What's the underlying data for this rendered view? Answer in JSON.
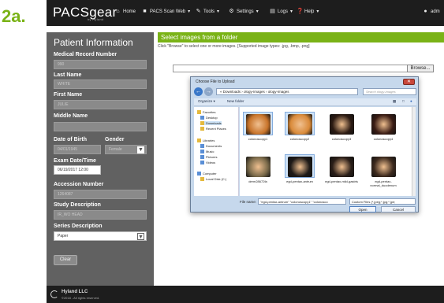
{
  "step_label": "2a.",
  "app": {
    "brand": "PACSgear",
    "brand_sub": "by Hyland",
    "nav": [
      {
        "label": "Home",
        "icon": "home-icon"
      },
      {
        "label": "PACS Scan Web",
        "icon": "camera-icon"
      },
      {
        "label": "Tools",
        "icon": "wrench-icon"
      },
      {
        "label": "Settings",
        "icon": "gear-icon"
      },
      {
        "label": "Logs",
        "icon": "list-icon"
      },
      {
        "label": "Help",
        "icon": "help-icon"
      }
    ],
    "user": "adm"
  },
  "sidebar": {
    "title": "Patient Information",
    "mrn_label": "Medical Record Number",
    "mrn_value": "990",
    "last_name_label": "Last Name",
    "last_name_value": "WHITE",
    "first_name_label": "First Name",
    "first_name_value": "JULIE",
    "middle_name_label": "Middle Name",
    "middle_name_value": "",
    "dob_label": "Date of Birth",
    "dob_value": "04/01/1945",
    "gender_label": "Gender",
    "gender_value": "Female",
    "exam_label": "Exam Date/Time",
    "exam_value": "06/19/2017 12:00",
    "accession_label": "Accession Number",
    "accession_value": "1264087",
    "study_label": "Study Description",
    "study_value": "IR_WO HEAD",
    "series_label": "Series Description",
    "series_value": "Paper",
    "clear_label": "Clear"
  },
  "main": {
    "header": "Select images from a folder",
    "description": "Click \"Browse\" to select one or more images. [Supported image types: .jpg, .bmp, .png]",
    "browse_label": "Browse..."
  },
  "dialog": {
    "title": "Choose File to Upload",
    "path": "« Downloads › ology-images › ology-images",
    "search_placeholder": "Search ology-images",
    "organize_label": "Organize ▾",
    "new_folder_label": "New folder",
    "nav": {
      "favorites": "Favorites",
      "desktop": "Desktop",
      "downloads": "Downloads",
      "recent": "Recent Places",
      "libraries": "Libraries",
      "documents": "Documents",
      "music": "Music",
      "pictures": "Pictures",
      "videos": "Videos",
      "computer": "Computer",
      "local_disk": "Local Disk (C:)"
    },
    "files": [
      {
        "name": "colonoscopy1",
        "selected": true,
        "color": "#c8742b"
      },
      {
        "name": "colonoscopy2",
        "selected": true,
        "color": "#d98a3a"
      },
      {
        "name": "colonoscopy3",
        "selected": false,
        "color": "#2b1a12"
      },
      {
        "name": "colonoscopy4",
        "selected": false,
        "color": "#3a1c14"
      },
      {
        "name": "derm28672fa",
        "selected": false,
        "color": "#7a6a4a"
      },
      {
        "name": "egd-pentax-antrum",
        "selected": true,
        "color": "#1e1a18"
      },
      {
        "name": "egd-pentax-mild-gastris",
        "selected": false,
        "color": "#2a1e18"
      },
      {
        "name": "egd-pentax-normal_duodenum",
        "selected": false,
        "color": "#3d2a1e"
      }
    ],
    "filename_label": "File name:",
    "filename_value": "\"egd-pentax-antrum\" \"colonoscopy1\" \"colonosco",
    "filetype_value": "Custom Files (*.jpeg;*.jpg;*.jpe;",
    "open_label": "Open",
    "cancel_label": "Cancel"
  },
  "footer": {
    "company": "Hyland LLC",
    "copyright": "©2018 - All rights reserved."
  }
}
